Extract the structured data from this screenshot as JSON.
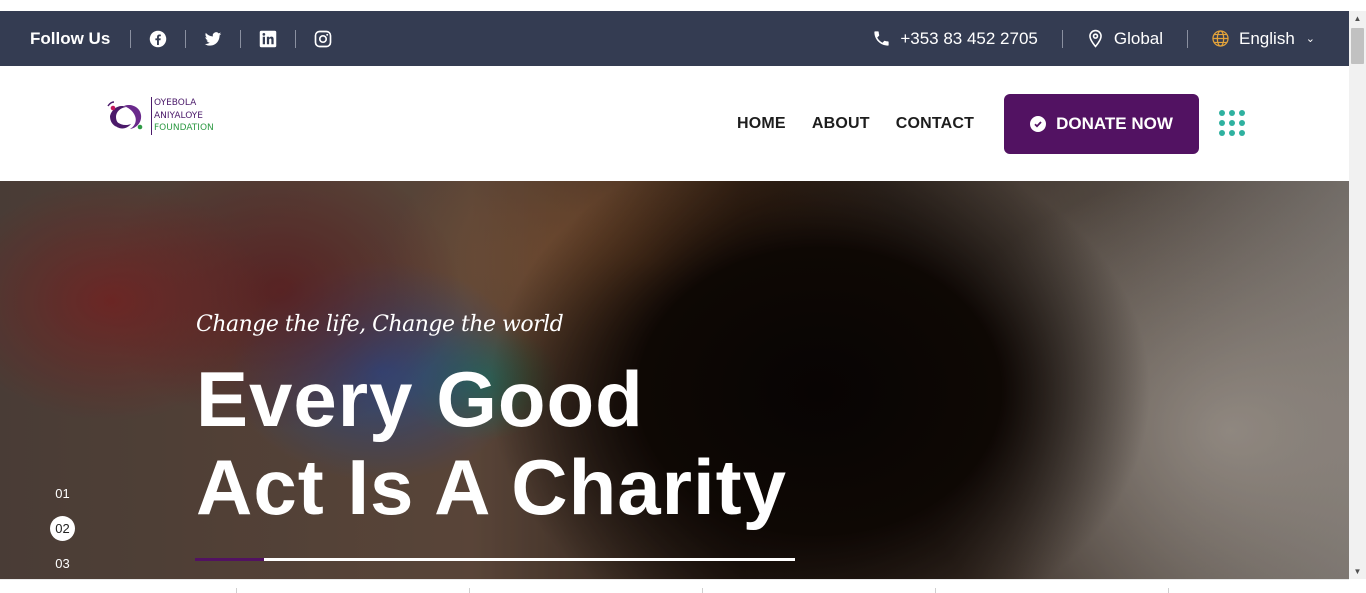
{
  "topbar": {
    "follow_label": "Follow Us",
    "socials": [
      {
        "name": "facebook-icon"
      },
      {
        "name": "twitter-icon"
      },
      {
        "name": "linkedin-icon"
      },
      {
        "name": "instagram-icon"
      }
    ],
    "phone": "+353 83 452 2705",
    "location": "Global",
    "language": "English",
    "background": "#343c52"
  },
  "header": {
    "logo": {
      "line1": "OYEBOLA",
      "line2": "ANIYALOYE",
      "line3": "FOUNDATION"
    },
    "nav": [
      "HOME",
      "ABOUT",
      "CONTACT"
    ],
    "donate_label": "DONATE NOW",
    "accent": "#521262",
    "menu_dot_color": "#2fb1a0"
  },
  "hero": {
    "tagline": "Change the life, Change the world",
    "headline_line1": "Every Good",
    "headline_line2": "Act Is A Charity",
    "slides": [
      "01",
      "02",
      "03"
    ],
    "active_slide": "02",
    "progress": 0.115
  }
}
